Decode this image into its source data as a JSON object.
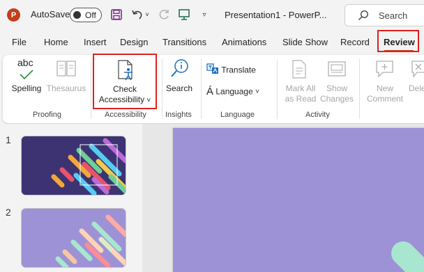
{
  "titlebar": {
    "app_logo": "P",
    "autosave_label": "AutoSave",
    "autosave_state": "Off",
    "document_title": "Presentation1  -  PowerP...",
    "search_placeholder": "Search",
    "icons": [
      "save-icon",
      "undo-icon",
      "redo-icon",
      "present-icon",
      "customize-icon",
      "search-icon"
    ]
  },
  "tabs": [
    {
      "label": "File"
    },
    {
      "label": "Home"
    },
    {
      "label": "Insert"
    },
    {
      "label": "Design"
    },
    {
      "label": "Transitions"
    },
    {
      "label": "Animations"
    },
    {
      "label": "Slide Show"
    },
    {
      "label": "Record"
    },
    {
      "label": "Review",
      "active": true
    }
  ],
  "ribbon": {
    "proofing": {
      "group_label": "Proofing",
      "spelling_icon_text": "abc",
      "spelling_label": "Spelling",
      "thesaurus_label": "Thesaurus"
    },
    "accessibility": {
      "group_label": "Accessibility",
      "check_line1": "Check",
      "check_line2": "Accessibility",
      "check_caret": "˅"
    },
    "insights": {
      "group_label": "Insights",
      "search_label": "Search"
    },
    "language": {
      "group_label": "Language",
      "translate_label": "Translate",
      "language_label": "Language",
      "language_caret": "˅"
    },
    "activity": {
      "group_label": "Activity",
      "mark_line1": "Mark All",
      "mark_line2": "as Read",
      "show_line1": "Show",
      "show_line2": "Changes"
    },
    "comments": {
      "new_line1": "New",
      "new_line2": "Comment",
      "delete_label": "Dele"
    }
  },
  "slides": [
    {
      "number": "1"
    },
    {
      "number": "2"
    }
  ],
  "colors": {
    "brand": "#c43e1c",
    "highlight": "#e02020",
    "slide_bg_1": "#3d3373",
    "slide_bg_2": "#9d92d6",
    "icon_blue": "#1e6fbd"
  }
}
